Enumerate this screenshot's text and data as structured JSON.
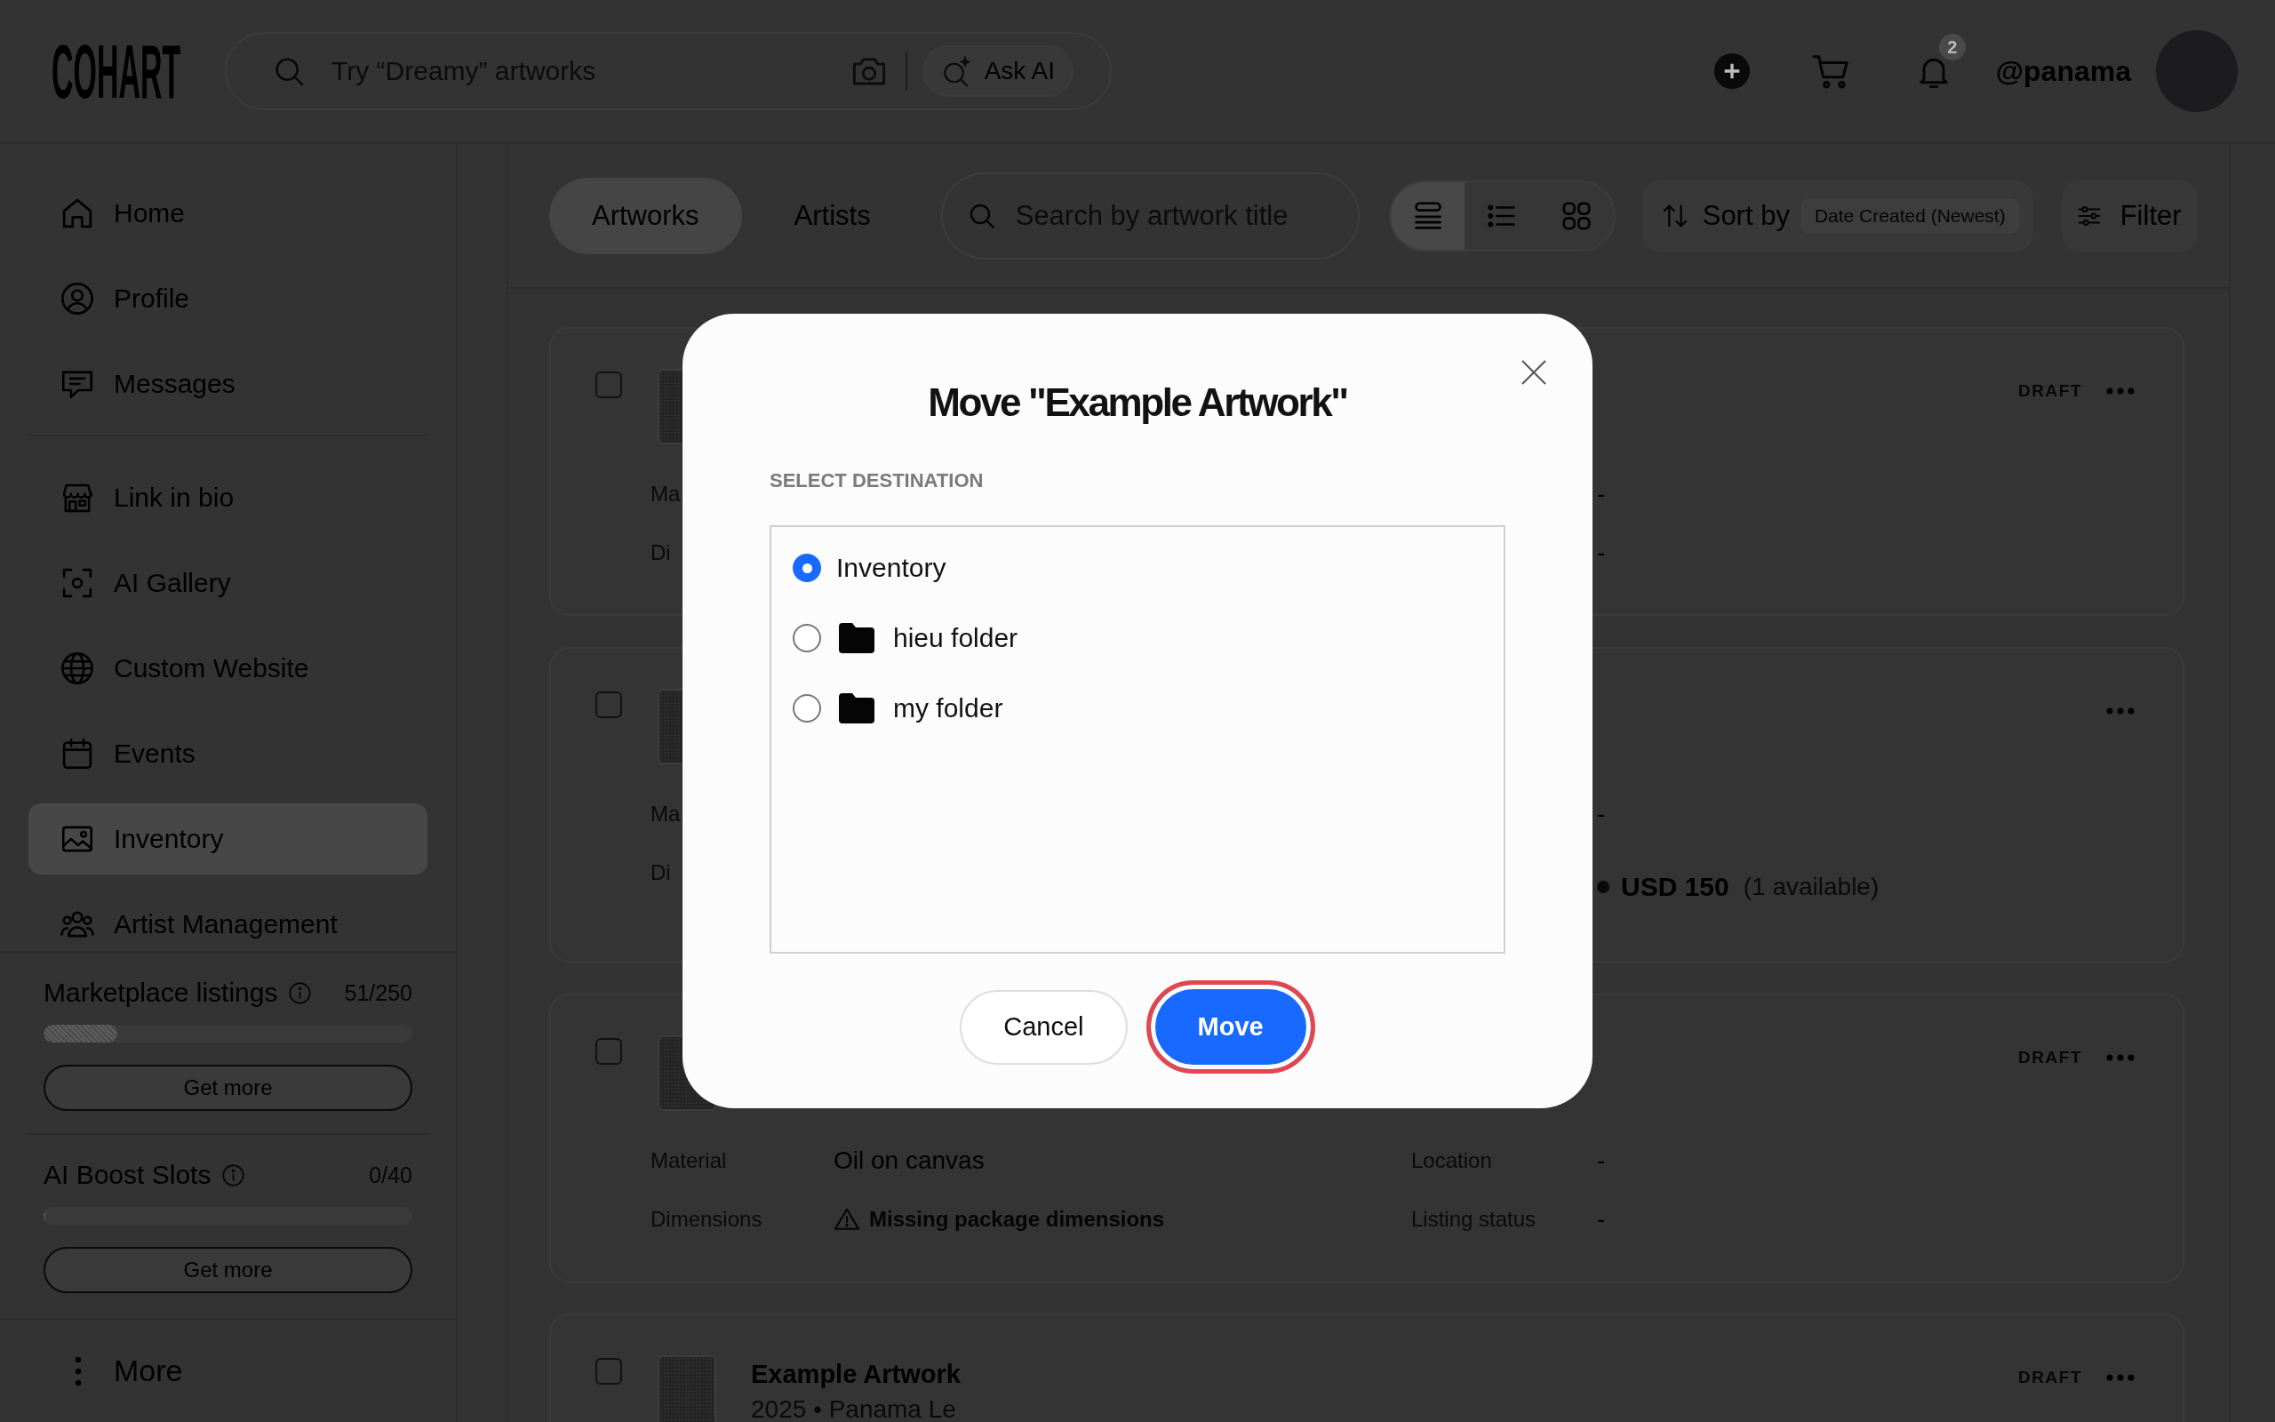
{
  "header": {
    "logo": "COHART",
    "search": {
      "placeholder": "Try “Dreamy” artworks"
    },
    "ask_ai": "Ask AI",
    "notifications": {
      "badge": "2"
    },
    "username": "@panama"
  },
  "sidebar": {
    "sections": [
      {
        "items": [
          {
            "label": "Home",
            "selected": false
          },
          {
            "label": "Profile",
            "selected": false
          },
          {
            "label": "Messages",
            "selected": false
          }
        ]
      },
      {
        "items": [
          {
            "label": "Link in bio",
            "selected": false
          },
          {
            "label": "AI Gallery",
            "selected": false
          },
          {
            "label": "Custom Website",
            "selected": false
          },
          {
            "label": "Events",
            "selected": false
          },
          {
            "label": "Inventory",
            "selected": true
          },
          {
            "label": "Artist Management",
            "selected": false
          }
        ]
      }
    ],
    "usage": [
      {
        "label": "Marketplace listings",
        "count": "51/250",
        "level": 0.2,
        "button": "Get more"
      },
      {
        "label": "AI Boost Slots",
        "count": "0/40",
        "level": 0,
        "button": "Get more"
      }
    ],
    "more": "More"
  },
  "toolbar": {
    "tabs": [
      {
        "label": "Artworks",
        "selected": true
      },
      {
        "label": "Artists",
        "selected": false
      }
    ],
    "search": {
      "placeholder": "Search by artwork title"
    },
    "views": [
      {
        "selected": true
      },
      {
        "selected": false
      },
      {
        "selected": false
      }
    ],
    "sort": {
      "label": "Sort by",
      "value": "Date Created (Newest)"
    },
    "filter": "Filter"
  },
  "cards": [
    {
      "checked": false,
      "status": "DRAFT",
      "rows": [
        {
          "label": "Ma",
          "value_2": "-"
        },
        {
          "label": "Di",
          "value_2": "-"
        }
      ]
    },
    {
      "checked": false,
      "rows": [
        {
          "label": "Ma",
          "value_2": "-"
        },
        {
          "label": "Di",
          "price": {
            "amount": "USD 150",
            "availability": "(1 available)"
          }
        }
      ]
    },
    {
      "checked": false,
      "status": "DRAFT",
      "rows": [
        {
          "label": "Material",
          "value": "Oil on canvas",
          "label_2": "Location",
          "value_2": "-"
        },
        {
          "label": "Dimensions",
          "warning": "Missing package dimensions",
          "label_2": "Listing status",
          "value_2": "-"
        }
      ]
    },
    {
      "checked": false,
      "title": "Example Artwork",
      "subtitle": "2025 • Panama Le",
      "status": "DRAFT"
    }
  ],
  "modal": {
    "title": "Move \"Example Artwork\"",
    "section_label": "SELECT DESTINATION",
    "destinations": [
      {
        "label": "Inventory",
        "kind": "root",
        "selected": true
      },
      {
        "label": "hieu folder",
        "kind": "folder",
        "selected": false
      },
      {
        "label": "my folder",
        "kind": "folder",
        "selected": false
      }
    ],
    "buttons": [
      {
        "label": "Cancel",
        "kind": "secondary",
        "focused": false
      },
      {
        "label": "Move",
        "kind": "primary",
        "focused": true
      }
    ]
  }
}
